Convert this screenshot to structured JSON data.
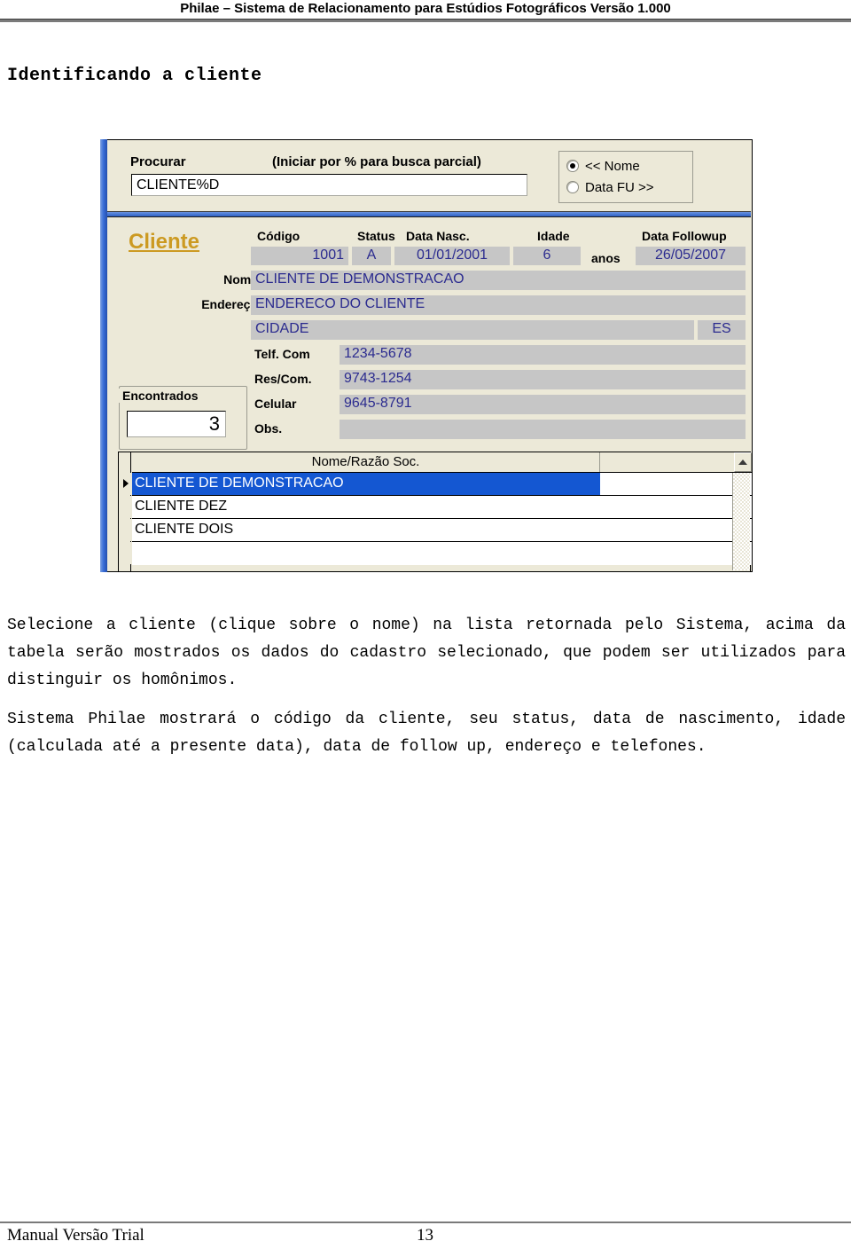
{
  "document": {
    "header_title": "Philae – Sistema de Relacionamento para Estúdios Fotográficos Versão 1.000",
    "section_heading": "Identificando a cliente",
    "paragraph_1": "Selecione a cliente (clique sobre o nome) na lista retornada pelo Sistema, acima da tabela serão mostrados os dados do cadastro selecionado, que podem ser utilizados para distinguir os homônimos.",
    "paragraph_2": "Sistema Philae mostrará o código da cliente, seu status, data de nascimento, idade (calculada até a presente data), data de follow up, endereço e telefones.",
    "footer_left": "Manual Versão Trial",
    "footer_page": "13"
  },
  "app": {
    "search": {
      "label": "Procurar",
      "hint": "(Iniciar por %  para busca  parcial)",
      "value": "CLIENTE%D",
      "placeholder": ""
    },
    "sort_options": {
      "option_name": "<< Nome",
      "option_datafu": "Data FU >>",
      "selected": "<< Nome"
    },
    "client": {
      "title": "Cliente",
      "headers": {
        "codigo": "Código",
        "status": "Status",
        "data_nasc": "Data Nasc.",
        "idade": "Idade",
        "data_followup": "Data Followup"
      },
      "labels": {
        "nome": "Nome",
        "endereco": "Endereço",
        "telf_com": "Telf. Com",
        "res_com": "Res/Com.",
        "celular": "Celular",
        "obs": "Obs.",
        "anos": "anos"
      },
      "values": {
        "codigo": "1001",
        "status": "A",
        "data_nasc": "01/01/2001",
        "idade": "6",
        "data_followup": "26/05/2007",
        "nome": "CLIENTE DE DEMONSTRACAO",
        "endereco": "ENDERECO DO CLIENTE",
        "cidade": "CIDADE",
        "uf": "ES",
        "telf_com": "1234-5678",
        "res_com": "9743-1254",
        "celular": "9645-8791",
        "obs": ""
      }
    },
    "found": {
      "label": "Encontrados",
      "count": "3"
    },
    "grid": {
      "column_header": "Nome/Razão Soc.",
      "rows": [
        {
          "name": "CLIENTE DE DEMONSTRACAO",
          "selected": true
        },
        {
          "name": "CLIENTE DEZ",
          "selected": false
        },
        {
          "name": "CLIENTE DOIS",
          "selected": false
        },
        {
          "name": "",
          "selected": false
        }
      ]
    },
    "colors": {
      "window_face": "#ece9d8",
      "accent_blue": "#2f5fbe",
      "selection_blue": "#1457d2",
      "field_gray": "#c6c6c6",
      "field_text": "#2b2b8f",
      "title_gold": "#cc9a22"
    }
  }
}
